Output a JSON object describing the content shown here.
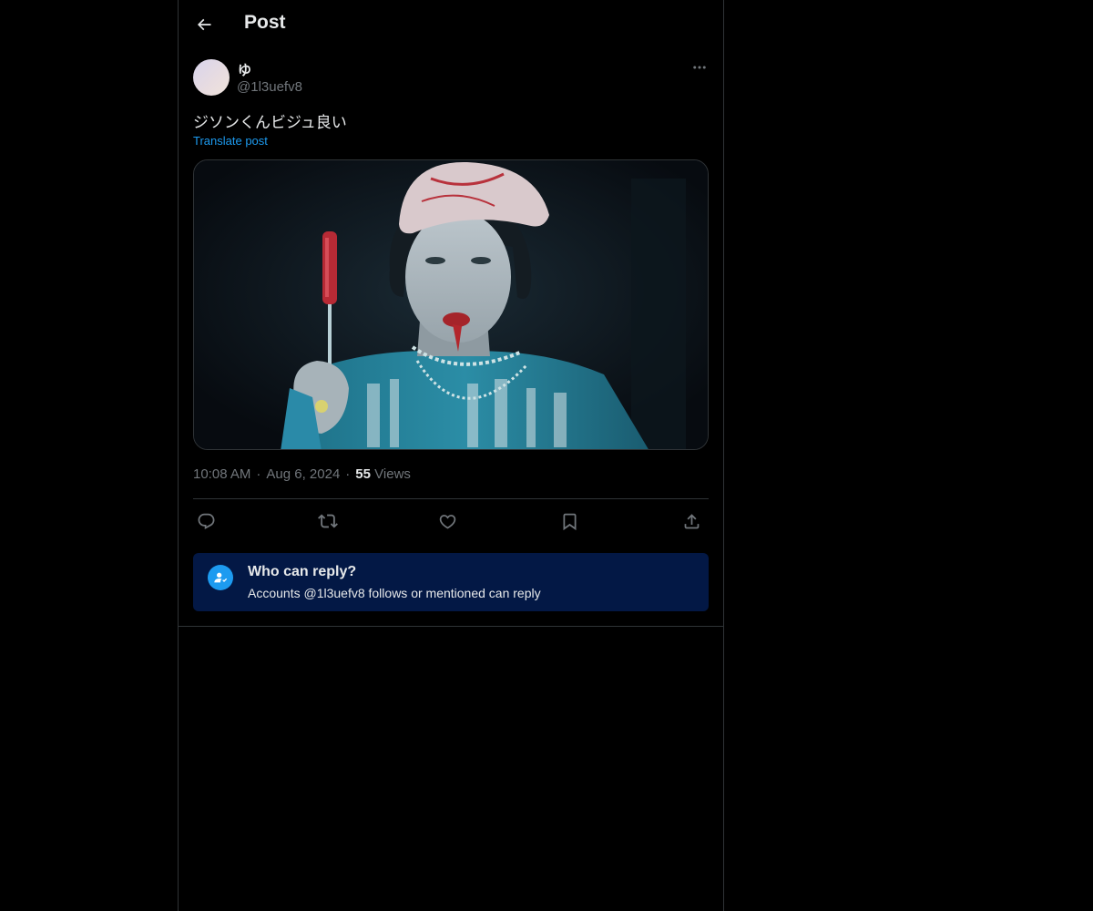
{
  "header": {
    "title": "Post",
    "back_icon": "arrow-left-icon"
  },
  "post": {
    "author": {
      "display_name": "ゆ",
      "handle": "@1l3uefv8"
    },
    "text": "ジソンくんビジュ良い",
    "translate_label": "Translate post",
    "time": "10:08 AM",
    "date": "Aug 6, 2024",
    "views_count": "55",
    "views_label": "Views",
    "dot": "·"
  },
  "actions": {
    "reply_icon": "comment-icon",
    "repost_icon": "repost-icon",
    "like_icon": "heart-icon",
    "bookmark_icon": "bookmark-icon",
    "share_icon": "share-icon"
  },
  "reply_restriction": {
    "title": "Who can reply?",
    "subtitle": "Accounts @1l3uefv8 follows or mentioned can reply"
  },
  "colors": {
    "background": "#000000",
    "text_primary": "#e7e9ea",
    "text_secondary": "#71767b",
    "accent": "#1d9bf0",
    "border": "#2f3336",
    "notice_background": "#031845"
  }
}
